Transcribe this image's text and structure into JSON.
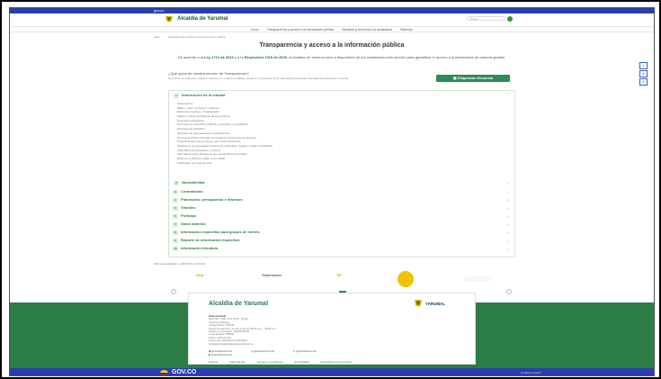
{
  "gov_bar": {
    "label": "gov.co"
  },
  "header": {
    "site_title": "Alcaldía de Yarumal",
    "search_placeholder": "Buscar"
  },
  "nav": {
    "items": [
      "Inicio",
      "Transparencia y acceso a la información pública",
      "Atención y servicios a la ciudadanía",
      "Participa"
    ]
  },
  "breadcrumb": {
    "items": [
      "Inicio",
      "Transparencia y acceso a la información pública"
    ]
  },
  "page": {
    "title": "Transparencia y acceso a la información pública",
    "intro_prefix": "De acuerdo a la ",
    "law": "Ley 1712 de 2014",
    "intro_mid": " y a la ",
    "resolution": "Resolución 1519 de 2020",
    "intro_suffix": ", la Alcaldía de Yarumal pone a disposición de los ciudadanos esta sección para garantizar el acceso a la información de manera gestión.",
    "help_question": "¿Qué opina de nuestra sección de Transparencia?",
    "help_desc": "Su opinión es vital para nosotros. Ayúdenos a mejorar la calidad, claridad y completitud de la información publicada respondiendo esta breve encuesta.",
    "survey_button": "Diligenciar Encuesta"
  },
  "accordion": {
    "open_section": {
      "number": "1",
      "label": "Información de la entidad"
    },
    "items": [
      "Presentación",
      "Misión, visión, funciones y deberes",
      "Estructura orgánica - Organigrama",
      "Mapas y cartas descriptivas de los procesos",
      "Directorio institucional",
      "Directorio de servidores públicos, empleados o contratistas",
      "Directorio de entidades",
      "Directorio de agremiaciones o asociaciones",
      "Servicio al Público, Normas, Formularios y Protocolos de Atención",
      "Procedimientos que se siguen para tomar decisiones",
      "Mecanismo de presentación directa de solicitudes, quejas y reclamos (PQRSD)",
      "Calendario de actividades y eventos",
      "Información sobre decisiones que puede afectar al Público",
      "Entes de control que vigilan a la entidad",
      "Publicación de hojas de vida"
    ],
    "sections": [
      {
        "number": "2",
        "label": "Normatividad"
      },
      {
        "number": "3",
        "label": "Contratación"
      },
      {
        "number": "4",
        "label": "Planeación, presupuesto e informes"
      },
      {
        "number": "5",
        "label": "Trámites"
      },
      {
        "number": "6",
        "label": "Participa"
      },
      {
        "number": "7",
        "label": "Datos abiertos"
      },
      {
        "number": "8",
        "label": "Información específica para grupos de interés"
      },
      {
        "number": "9",
        "label": "Reporte de información específica"
      },
      {
        "number": "10",
        "label": "Información tributaria"
      }
    ]
  },
  "updated": "Última actualización: 14/07/2021 11:30 AM",
  "logos": [
    "VIDA",
    "Gobernación",
    "TIC",
    "",
    ""
  ],
  "footer": {
    "title": "Alcaldía de Yarumal",
    "logo_text": "YARUMAL",
    "info": [
      "Sede principal",
      "Dirección: Calle 20 # 19-53 - El Rey",
      "Yarumal, Antioquia",
      "Código Postal: 517040",
      "Horario de atención: Lunes a viernes 08:00 a.m. - 05:00 p.m.",
      "Teléfono conmutador: (604)8530045",
      "Línea gratuita: 018000",
      "Correo institucional: ...",
      "Correo de notificaciones judiciales:",
      "notificacionesjudiciales@yarumal.gov.co"
    ],
    "social": [
      "@AlcaldiaYarumal",
      "@AlcaldiaYarumal",
      "@AlcaldiaYarumal",
      "@AlcaldiaYarumal"
    ],
    "links": [
      "Políticas",
      "Mapa del sitio",
      "Términos y condiciones",
      "Accesibilidad",
      "Privacidad de la información"
    ]
  },
  "gov_footer": {
    "brand": "GOV.CO",
    "right": "Alcaldía de Yarumal"
  }
}
